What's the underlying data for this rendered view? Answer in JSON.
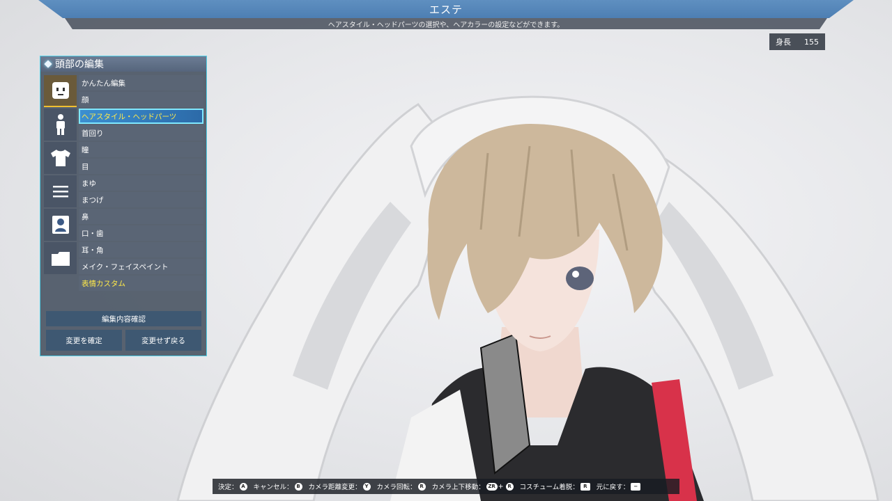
{
  "banner": {
    "title": "エステ",
    "subtitle": "ヘアスタイル・ヘッドパーツの選択や、ヘアカラーの設定などができます。"
  },
  "height": {
    "label": "身長",
    "value": "155"
  },
  "panel": {
    "title": "頭部の編集",
    "categories": [
      {
        "icon": "face-icon",
        "active": true
      },
      {
        "icon": "body-icon"
      },
      {
        "icon": "shirt-icon"
      },
      {
        "icon": "list-icon"
      },
      {
        "icon": "profile-icon"
      },
      {
        "icon": "folder-icon"
      }
    ],
    "items": [
      {
        "label": "かんたん編集"
      },
      {
        "label": "顔"
      },
      {
        "label": "ヘアスタイル・ヘッドパーツ",
        "selected": true
      },
      {
        "label": "首回り"
      },
      {
        "label": "瞳"
      },
      {
        "label": "目"
      },
      {
        "label": "まゆ"
      },
      {
        "label": "まつげ"
      },
      {
        "label": "鼻"
      },
      {
        "label": "口・歯"
      },
      {
        "label": "耳・角"
      },
      {
        "label": "メイク・フェイスペイント"
      },
      {
        "label": "表情カスタム",
        "highlight": true
      }
    ],
    "confirm_edits": "編集内容確認",
    "apply_changes": "変更を確定",
    "discard_changes": "変更せず戻る"
  },
  "hints": [
    {
      "label": "決定：",
      "key": "A"
    },
    {
      "label": "キャンセル：",
      "key": "B"
    },
    {
      "label": "カメラ距離変更：",
      "key": "Y"
    },
    {
      "label": "カメラ回転：",
      "key": "R"
    },
    {
      "label": "カメラ上下移動：",
      "key": "ZR",
      "plus": "+",
      "key2": "R"
    },
    {
      "label": "コスチューム着脱：",
      "key": "R"
    },
    {
      "label": "元に戻す：",
      "key": "−"
    }
  ],
  "colors": {
    "banner": "#5585b8",
    "panel_border": "#4fd0e8",
    "highlight_text": "#ffe94a",
    "selected_row": "#3c8fd0"
  }
}
